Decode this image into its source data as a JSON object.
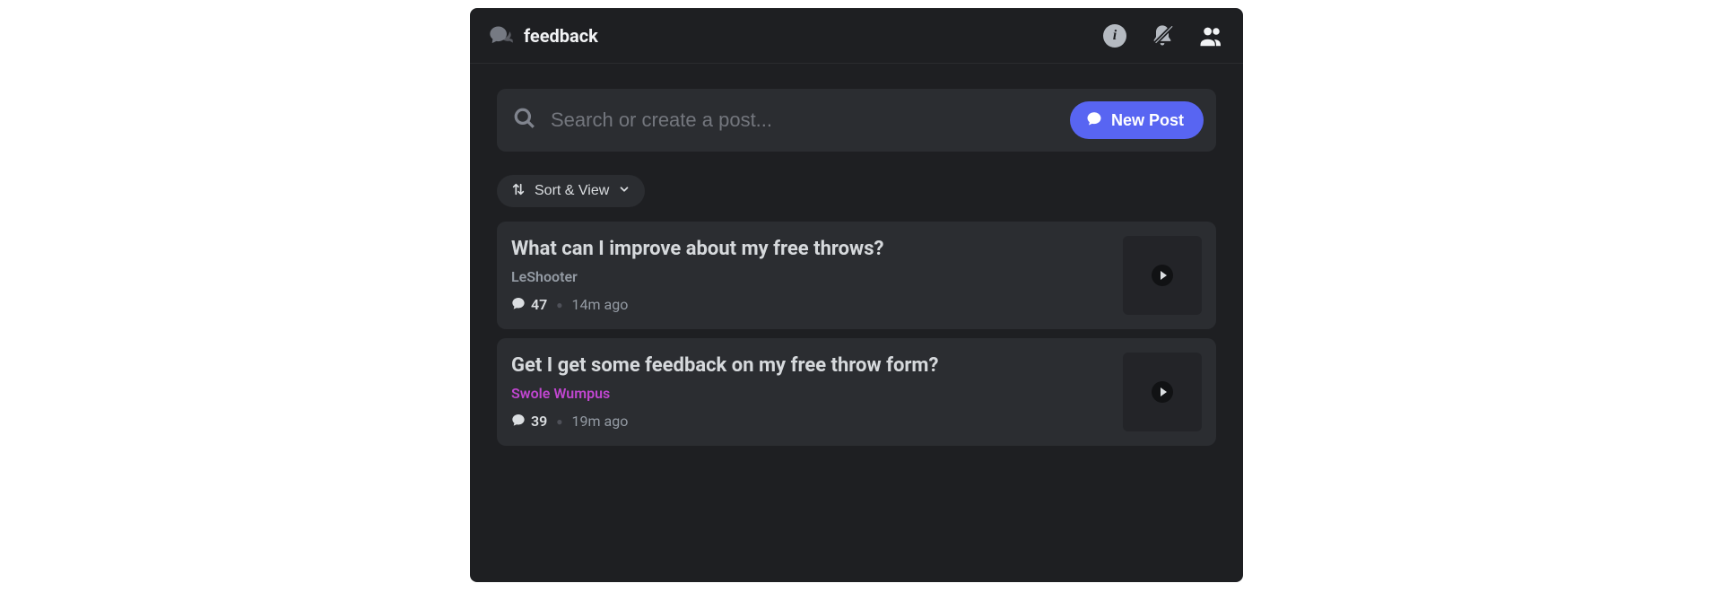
{
  "header": {
    "channel_name": "feedback"
  },
  "search": {
    "placeholder": "Search or create a post...",
    "new_post_label": "New Post"
  },
  "toolbar": {
    "sort_view_label": "Sort & View"
  },
  "posts": [
    {
      "title": "What can I improve about my free throws?",
      "author": "LeShooter",
      "author_color": "#949ba4",
      "comment_count": "47",
      "time_ago": "14m ago"
    },
    {
      "title": "Get I get some feedback on my free throw form?",
      "author": "Swole Wumpus",
      "author_color": "#c046d0",
      "comment_count": "39",
      "time_ago": "19m ago"
    }
  ]
}
